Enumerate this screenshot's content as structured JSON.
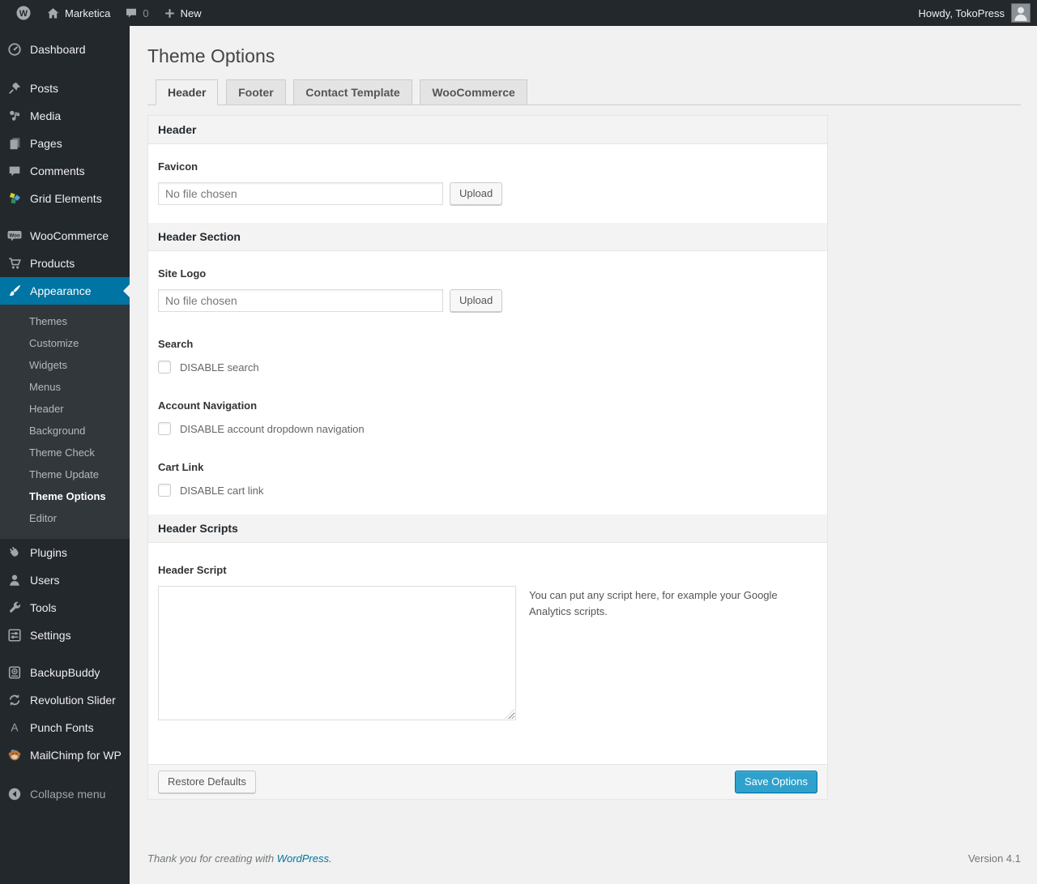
{
  "colors": {
    "accent": "#0074a2",
    "admin_bar_bg": "#23282d",
    "submenu_bg": "#32373c",
    "primary_button": "#2ea2cc",
    "link": "#0074a2",
    "page_bg": "#f1f1f1"
  },
  "admin_bar": {
    "site_name": "Marketica",
    "comment_count": "0",
    "new_label": "New",
    "howdy": "Howdy, TokoPress"
  },
  "sidebar": {
    "items": [
      {
        "label": "Dashboard",
        "icon": "dashboard"
      },
      {
        "label": "Posts",
        "icon": "pin"
      },
      {
        "label": "Media",
        "icon": "media"
      },
      {
        "label": "Pages",
        "icon": "pages"
      },
      {
        "label": "Comments",
        "icon": "comments"
      },
      {
        "label": "Grid Elements",
        "icon": "grid-elements"
      },
      {
        "label": "WooCommerce",
        "icon": "woocommerce"
      },
      {
        "label": "Products",
        "icon": "cart"
      },
      {
        "label": "Appearance",
        "icon": "paintbrush",
        "active": true
      },
      {
        "label": "Plugins",
        "icon": "plugin"
      },
      {
        "label": "Users",
        "icon": "users"
      },
      {
        "label": "Tools",
        "icon": "wrench"
      },
      {
        "label": "Settings",
        "icon": "settings"
      },
      {
        "label": "BackupBuddy",
        "icon": "backup"
      },
      {
        "label": "Revolution Slider",
        "icon": "revolution-slider"
      },
      {
        "label": "Punch Fonts",
        "icon": "font"
      },
      {
        "label": "MailChimp for WP",
        "icon": "mailchimp"
      }
    ],
    "appearance_submenu": {
      "items": [
        "Themes",
        "Customize",
        "Widgets",
        "Menus",
        "Header",
        "Background",
        "Theme Check",
        "Theme Update",
        "Theme Options",
        "Editor"
      ],
      "current": "Theme Options"
    },
    "collapse_label": "Collapse menu"
  },
  "page": {
    "title": "Theme Options",
    "tabs": [
      {
        "label": "Header",
        "active": true
      },
      {
        "label": "Footer",
        "active": false
      },
      {
        "label": "Contact Template",
        "active": false
      },
      {
        "label": "WooCommerce",
        "active": false
      }
    ]
  },
  "panel": {
    "bars": {
      "header": "Header",
      "header_section": "Header Section",
      "header_scripts": "Header Scripts"
    },
    "fields": {
      "favicon": {
        "label": "Favicon",
        "file_value": "No file chosen",
        "upload_label": "Upload"
      },
      "site_logo": {
        "label": "Site Logo",
        "file_value": "No file chosen",
        "upload_label": "Upload"
      },
      "search": {
        "label": "Search",
        "checkbox_label": "DISABLE search",
        "checked": false
      },
      "account_navigation": {
        "label": "Account Navigation",
        "checkbox_label": "DISABLE account dropdown navigation",
        "checked": false
      },
      "cart_link": {
        "label": "Cart Link",
        "checkbox_label": "DISABLE cart link",
        "checked": false
      },
      "header_script": {
        "label": "Header Script",
        "value": "",
        "help": "You can put any script here, for example your Google Analytics scripts."
      }
    },
    "actions": {
      "restore": "Restore Defaults",
      "save": "Save Options"
    }
  },
  "footer": {
    "thanks_prefix": "Thank you for creating with",
    "wordpress_link": "WordPress.",
    "version": "Version 4.1"
  }
}
